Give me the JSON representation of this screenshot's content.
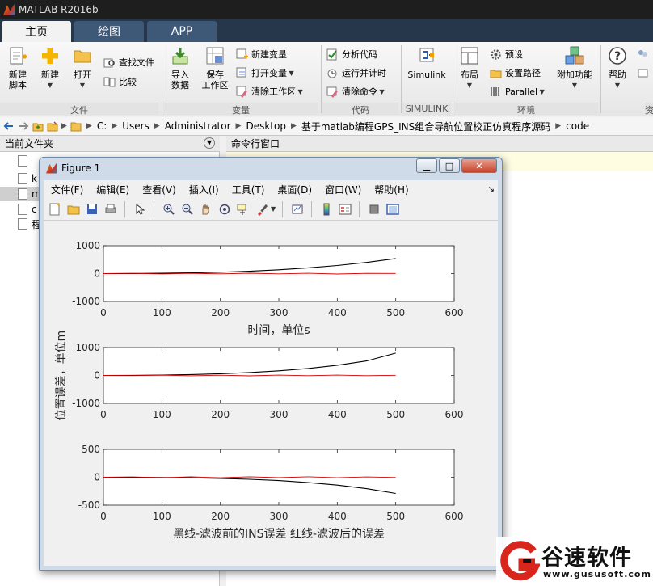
{
  "app": {
    "title": "MATLAB R2016b"
  },
  "tabs": [
    {
      "label": "主页",
      "active": true
    },
    {
      "label": "绘图",
      "active": false
    },
    {
      "label": "APP",
      "active": false
    }
  ],
  "ribbon": {
    "file": {
      "new_script": "新建\n脚本",
      "new": "新建",
      "open": "打开",
      "find_files": "查找文件",
      "compare": "比较",
      "group": "文件"
    },
    "variable": {
      "import": "导入\n数据",
      "save_ws": "保存\n工作区",
      "new_var": "新建变量",
      "open_var": "打开变量",
      "clear_ws": "清除工作区",
      "group": "变量"
    },
    "code": {
      "analyze": "分析代码",
      "run_time": "运行并计时",
      "clear_cmd": "清除命令",
      "group": "代码"
    },
    "simulink": {
      "label": "Simulink",
      "group": "SIMULINK"
    },
    "environment": {
      "layout": "布局",
      "prefs": "预设",
      "set_path": "设置路径",
      "parallel": "Parallel",
      "addons": "附加功能",
      "group": "环境"
    },
    "resources": {
      "help": "帮助",
      "group": "资"
    }
  },
  "address": {
    "segments": [
      "C:",
      "Users",
      "Administrator",
      "Desktop",
      "基于matlab编程GPS_INS组合导航位置校正仿真程序源码",
      "code"
    ]
  },
  "panels": {
    "current_folder": "当前文件夹",
    "command_window": "命令行窗口",
    "files": [
      "k",
      "m",
      "c",
      "程"
    ]
  },
  "figure": {
    "title": "Figure 1",
    "menu": [
      "文件(F)",
      "编辑(E)",
      "查看(V)",
      "插入(I)",
      "工具(T)",
      "桌面(D)",
      "窗口(W)",
      "帮助(H)"
    ],
    "xlabel_top": "时间，单位s",
    "ylabel_mid": "位置误差，单位m",
    "xlabel_bottom": "黑线-滤波前的INS误差   红线-滤波后的误差"
  },
  "colors": {
    "black_series": "#000000",
    "red_series": "#d40000"
  },
  "chart_data": [
    {
      "type": "line",
      "xlim": [
        0,
        600
      ],
      "ylim": [
        -1000,
        1000
      ],
      "xticks": [
        0,
        100,
        200,
        300,
        400,
        500,
        600
      ],
      "yticks": [
        -1000,
        0,
        1000
      ],
      "xlabel": "时间，单位s",
      "ylabel": "",
      "series": [
        {
          "color": "#000000",
          "x": [
            0,
            50,
            100,
            150,
            200,
            250,
            300,
            350,
            400,
            450,
            500
          ],
          "y": [
            0,
            3,
            11,
            26,
            50,
            85,
            135,
            205,
            290,
            400,
            540
          ]
        },
        {
          "color": "#d40000",
          "x": [
            0,
            50,
            100,
            150,
            200,
            250,
            300,
            350,
            400,
            450,
            500
          ],
          "y": [
            0,
            8,
            -12,
            10,
            -8,
            15,
            -10,
            12,
            -14,
            10,
            5
          ]
        }
      ]
    },
    {
      "type": "line",
      "xlim": [
        0,
        600
      ],
      "ylim": [
        -1000,
        1000
      ],
      "xticks": [
        0,
        100,
        200,
        300,
        400,
        500,
        600
      ],
      "yticks": [
        -1000,
        0,
        1000
      ],
      "xlabel": "",
      "ylabel": "位置误差，单位m",
      "series": [
        {
          "color": "#000000",
          "x": [
            0,
            50,
            100,
            150,
            200,
            250,
            300,
            350,
            400,
            450,
            500
          ],
          "y": [
            0,
            4,
            14,
            33,
            62,
            105,
            165,
            250,
            365,
            520,
            800
          ]
        },
        {
          "color": "#d40000",
          "x": [
            0,
            50,
            100,
            150,
            200,
            250,
            300,
            350,
            400,
            450,
            500
          ],
          "y": [
            0,
            -6,
            10,
            -12,
            9,
            -14,
            11,
            -10,
            13,
            -9,
            6
          ]
        }
      ]
    },
    {
      "type": "line",
      "xlim": [
        0,
        600
      ],
      "ylim": [
        -500,
        500
      ],
      "xticks": [
        0,
        100,
        200,
        300,
        400,
        500,
        600
      ],
      "yticks": [
        -500,
        0,
        500
      ],
      "xlabel": "黑线-滤波前的INS误差   红线-滤波后的误差",
      "ylabel": "",
      "series": [
        {
          "color": "#000000",
          "x": [
            0,
            50,
            100,
            150,
            200,
            250,
            300,
            350,
            400,
            450,
            500
          ],
          "y": [
            0,
            -1,
            -4,
            -10,
            -20,
            -36,
            -60,
            -95,
            -140,
            -205,
            -290
          ]
        },
        {
          "color": "#d40000",
          "x": [
            0,
            50,
            100,
            150,
            200,
            250,
            300,
            350,
            400,
            450,
            500
          ],
          "y": [
            0,
            6,
            -8,
            7,
            -9,
            8,
            -7,
            9,
            -8,
            6,
            -4
          ]
        }
      ]
    }
  ],
  "watermark": {
    "brand": "谷速软件",
    "url": "www.gususoft.com"
  }
}
